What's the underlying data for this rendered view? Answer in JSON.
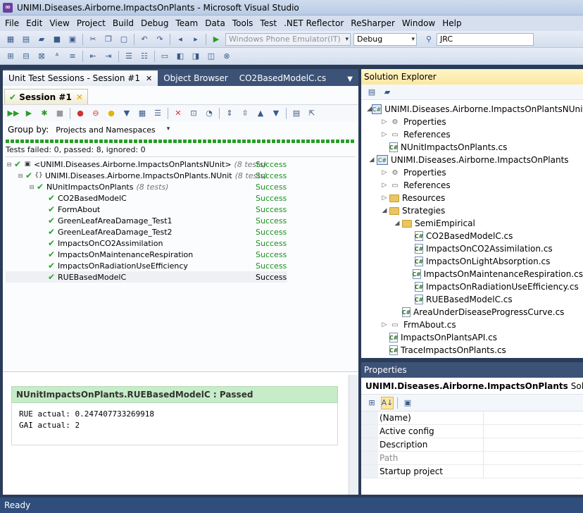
{
  "window": {
    "title": "UNIMI.Diseases.Airborne.ImpactsOnPlants - Microsoft Visual Studio"
  },
  "menu": [
    "File",
    "Edit",
    "View",
    "Project",
    "Build",
    "Debug",
    "Team",
    "Data",
    "Tools",
    "Test",
    ".NET Reflector",
    "ReSharper",
    "Window",
    "Help"
  ],
  "toolbar": {
    "target_device": "Windows Phone Emulator(IT)",
    "configuration": "Debug",
    "find_text": "JRC"
  },
  "doc_tabs": [
    {
      "label": "Unit Test Sessions - Session #1",
      "active": true
    },
    {
      "label": "Object Browser",
      "active": false
    },
    {
      "label": "CO2BasedModelC.cs",
      "active": false
    }
  ],
  "session": {
    "tab_label": "Session #1",
    "group_by_label": "Group by:",
    "group_by_value": "Projects and Namespaces",
    "summary": "Tests failed: 0, passed: 8, ignored: 0",
    "tests": [
      {
        "name": "<UNIMI.Diseases.Airborne.ImpactsOnPlantsNUnit>",
        "count": "(8 tests)",
        "status": "Success",
        "level": 0
      },
      {
        "name": "UNIMI.Diseases.Airborne.ImpactsOnPlants.NUnit",
        "count": "(8 tests)",
        "status": "Success",
        "level": 1
      },
      {
        "name": "NUnitImpactsOnPlants",
        "count": "(8 tests)",
        "status": "Success",
        "level": 2
      },
      {
        "name": "CO2BasedModelC",
        "count": "",
        "status": "Success",
        "level": 3
      },
      {
        "name": "FormAbout",
        "count": "",
        "status": "Success",
        "level": 3
      },
      {
        "name": "GreenLeafAreaDamage_Test1",
        "count": "",
        "status": "Success",
        "level": 3
      },
      {
        "name": "GreenLeafAreaDamage_Test2",
        "count": "",
        "status": "Success",
        "level": 3
      },
      {
        "name": "ImpactsOnCO2Assimilation",
        "count": "",
        "status": "Success",
        "level": 3
      },
      {
        "name": "ImpactsOnMaintenanceRespiration",
        "count": "",
        "status": "Success",
        "level": 3
      },
      {
        "name": "ImpactsOnRadiationUseEfficiency",
        "count": "",
        "status": "Success",
        "level": 3
      },
      {
        "name": "RUEBasedModelC",
        "count": "",
        "status": "Success",
        "level": 3
      }
    ]
  },
  "output": {
    "result_title": "NUnitImpactsOnPlants.RUEBasedModelC : Passed",
    "line1": "RUE actual: 0.247407733269918",
    "line2": "GAI actual: 2"
  },
  "solution_explorer": {
    "title": "Solution Explorer",
    "items": [
      {
        "label": "UNIMI.Diseases.Airborne.ImpactsOnPlantsNUnit",
        "indent": 0,
        "icon": "project-icon",
        "exp": "◢"
      },
      {
        "label": "Properties",
        "indent": 1,
        "icon": "wrench-icon",
        "exp": "▷"
      },
      {
        "label": "References",
        "indent": 1,
        "icon": "references-icon",
        "exp": "▷"
      },
      {
        "label": "NUnitImpactsOnPlants.cs",
        "indent": 1,
        "icon": "cs-file-icon",
        "exp": ""
      },
      {
        "label": "UNIMI.Diseases.Airborne.ImpactsOnPlants",
        "indent": 0,
        "icon": "project-icon",
        "exp": "◢"
      },
      {
        "label": "Properties",
        "indent": 1,
        "icon": "wrench-icon",
        "exp": "▷"
      },
      {
        "label": "References",
        "indent": 1,
        "icon": "references-icon",
        "exp": "▷"
      },
      {
        "label": "Resources",
        "indent": 1,
        "icon": "folder-icon",
        "exp": "▷"
      },
      {
        "label": "Strategies",
        "indent": 1,
        "icon": "folder-open-icon",
        "exp": "◢"
      },
      {
        "label": "SemiEmpirical",
        "indent": 2,
        "icon": "folder-open-icon",
        "exp": "◢"
      },
      {
        "label": "CO2BasedModelC.cs",
        "indent": 3,
        "icon": "cs-file-icon",
        "exp": ""
      },
      {
        "label": "ImpactsOnCO2Assimilation.cs",
        "indent": 3,
        "icon": "cs-file-icon",
        "exp": ""
      },
      {
        "label": "ImpactsOnLightAbsorption.cs",
        "indent": 3,
        "icon": "cs-file-icon",
        "exp": ""
      },
      {
        "label": "ImpactsOnMaintenanceRespiration.cs",
        "indent": 3,
        "icon": "cs-file-icon",
        "exp": ""
      },
      {
        "label": "ImpactsOnRadiationUseEfficiency.cs",
        "indent": 3,
        "icon": "cs-file-icon",
        "exp": ""
      },
      {
        "label": "RUEBasedModelC.cs",
        "indent": 3,
        "icon": "cs-file-icon",
        "exp": ""
      },
      {
        "label": "AreaUnderDiseaseProgressCurve.cs",
        "indent": 2,
        "icon": "cs-file-icon",
        "exp": ""
      },
      {
        "label": "FrmAbout.cs",
        "indent": 1,
        "icon": "form-icon",
        "exp": "▷"
      },
      {
        "label": "ImpactsOnPlantsAPI.cs",
        "indent": 1,
        "icon": "cs-file-icon",
        "exp": ""
      },
      {
        "label": "TraceImpactsOnPlants.cs",
        "indent": 1,
        "icon": "cs-file-icon",
        "exp": ""
      }
    ]
  },
  "properties": {
    "title": "Properties",
    "object_name": "UNIMI.Diseases.Airborne.ImpactsOnPlants",
    "object_type": "Solution Prop",
    "rows": [
      {
        "name": "(Name)",
        "dim": false
      },
      {
        "name": "Active config",
        "dim": false
      },
      {
        "name": "Description",
        "dim": false
      },
      {
        "name": "Path",
        "dim": true
      },
      {
        "name": "Startup project",
        "dim": false
      }
    ]
  },
  "status": {
    "text": "Ready"
  }
}
